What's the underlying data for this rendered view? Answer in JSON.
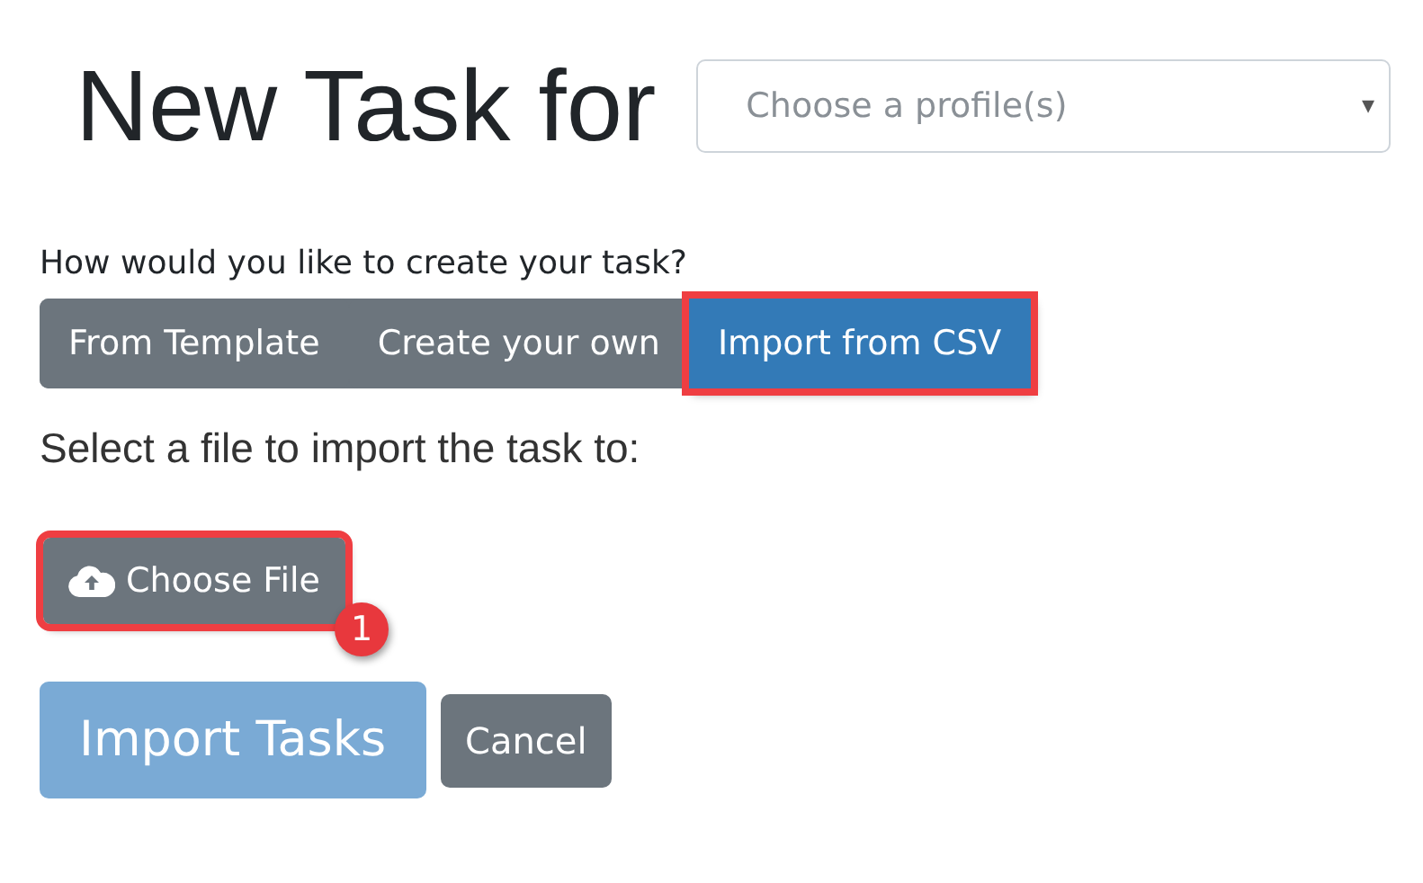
{
  "heading": "New Task for",
  "profile_select": {
    "placeholder": "Choose a profile(s)",
    "caret": "▾"
  },
  "prompt": "How would you like to create your task?",
  "tabs": [
    {
      "label": "From Template",
      "selected": false,
      "highlighted": false
    },
    {
      "label": "Create your own",
      "selected": false,
      "highlighted": false
    },
    {
      "label": "Import from CSV",
      "selected": true,
      "highlighted": true
    }
  ],
  "file_label": "Select a file to import the task to:",
  "choose_file": {
    "label": "Choose File",
    "highlighted": true,
    "badge": "1"
  },
  "buttons": [
    {
      "label": "Import Tasks",
      "kind": "primary",
      "disabled": true
    },
    {
      "label": "Cancel",
      "kind": "secondary",
      "disabled": false
    }
  ]
}
